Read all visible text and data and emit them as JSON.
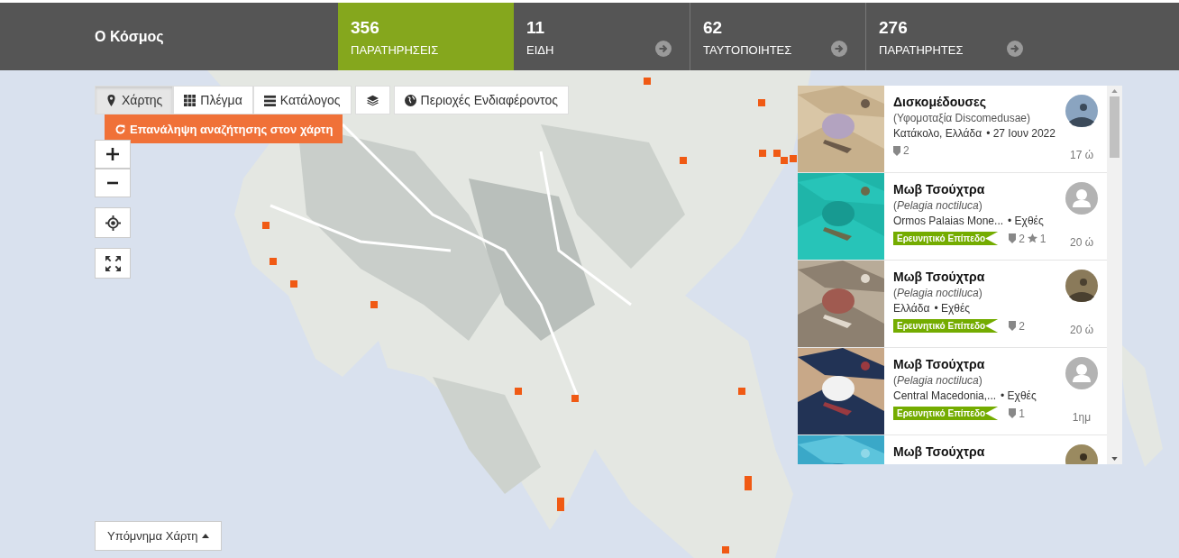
{
  "header": {
    "title": "Ο Κόσμος",
    "stats": [
      {
        "count": "356",
        "label": "ΠΑΡΑΤΗΡΗΣΕΙΣ",
        "selected": true,
        "arrow": false
      },
      {
        "count": "11",
        "label": "ΕΙΔΗ",
        "selected": false,
        "arrow": true
      },
      {
        "count": "62",
        "label": "ΤΑΥΤΟΠΟΙΗΤΕΣ",
        "selected": false,
        "arrow": true
      },
      {
        "count": "276",
        "label": "ΠΑΡΑΤΗΡΗΤΕΣ",
        "selected": false,
        "arrow": true
      }
    ]
  },
  "view_tabs": [
    {
      "label": "Χάρτης",
      "kind": "pin",
      "selected": true
    },
    {
      "label": "Πλέγμα",
      "kind": "grid",
      "selected": false
    },
    {
      "label": "Κατάλογος",
      "kind": "list",
      "selected": false
    }
  ],
  "places_button": {
    "label": "Περιοχές Ενδιαφέροντος"
  },
  "redo_search": {
    "label": "Επανάληψη αναζήτησης στον χάρτη"
  },
  "legend_button": {
    "label": "Υπόμνημα Χάρτη"
  },
  "observations": [
    {
      "title": "Δισκομέδουσες",
      "taxon": "(Υφομοταξία Discomedusae)",
      "place": "Κατάκολο, Ελλάδα",
      "date": "• 27 Ιουν 2022",
      "research_grade": false,
      "ids": "2",
      "age": "17 ώ",
      "user_photo": true
    },
    {
      "title": "Μωβ Τσούχτρα",
      "taxon": "(*Pelagia noctiluca*)",
      "place": "Ormos Palaias Mone...",
      "date": "• Εχθές",
      "research_grade": true,
      "grade_label": "Ερευνητικό Επίπεδο",
      "ids": "2",
      "faves": "1",
      "age": "20 ώ",
      "user_photo": false
    },
    {
      "title": "Μωβ Τσούχτρα",
      "taxon": "(*Pelagia noctiluca*)",
      "place": "Ελλάδα",
      "date": "• Εχθές",
      "research_grade": true,
      "grade_label": "Ερευνητικό Επίπεδο",
      "ids": "2",
      "age": "20 ώ",
      "user_photo": true
    },
    {
      "title": "Μωβ Τσούχτρα",
      "taxon": "(*Pelagia noctiluca*)",
      "place": "Central Macedonia,...",
      "date": "• Εχθές",
      "research_grade": true,
      "grade_label": "Ερευνητικό Επίπεδο",
      "ids": "1",
      "age": "1ημ",
      "user_photo": false
    },
    {
      "title": "Μωβ Τσούχτρα",
      "user_photo": true
    }
  ]
}
